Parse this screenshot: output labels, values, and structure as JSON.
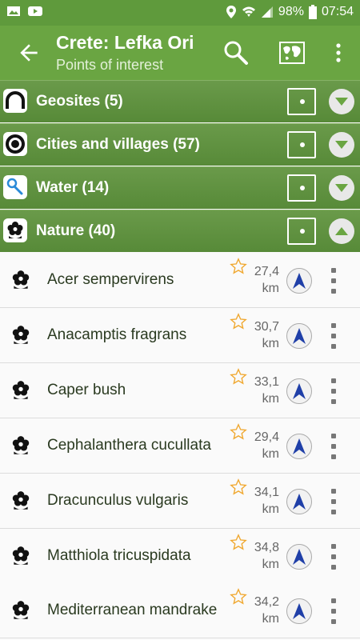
{
  "status_bar": {
    "battery": "98%",
    "time": "07:54",
    "left_icons": [
      "gallery-icon",
      "youtube-icon"
    ],
    "right_icons": [
      "location-icon",
      "wifi-icon",
      "signal-icon",
      "battery-icon"
    ]
  },
  "app_bar": {
    "title": "Crete: Lefka Ori",
    "subtitle": "Points of interest",
    "actions": [
      "search-icon",
      "map-icon",
      "more-vert-icon"
    ]
  },
  "categories": [
    {
      "label": "Geosites (5)",
      "icon": "geosite-icon",
      "expanded": false
    },
    {
      "label": "Cities and villages (57)",
      "icon": "city-icon",
      "expanded": false
    },
    {
      "label": "Water (14)",
      "icon": "water-icon",
      "expanded": false
    },
    {
      "label": "Nature (40)",
      "icon": "nature-icon",
      "expanded": true
    }
  ],
  "items": [
    {
      "name": "Acer sempervirens",
      "distance": "27,4",
      "unit": "km"
    },
    {
      "name": "Anacamptis fragrans",
      "distance": "30,7",
      "unit": "km"
    },
    {
      "name": "Caper bush",
      "distance": "33,1",
      "unit": "km"
    },
    {
      "name": "Cephalanthera cucullata",
      "distance": "29,4",
      "unit": "km"
    },
    {
      "name": "Dracunculus vulgaris",
      "distance": "34,1",
      "unit": "km"
    },
    {
      "name": "Matthiola tricuspidata",
      "distance": "34,8",
      "unit": "km"
    },
    {
      "name": "Mediterranean mandrake",
      "distance": "34,2",
      "unit": "km"
    }
  ],
  "colors": {
    "appbar": "#6aa542",
    "statusbar": "#5f9a3c",
    "star": "#f0a830",
    "nav_arrow": "#1f3fa8"
  }
}
